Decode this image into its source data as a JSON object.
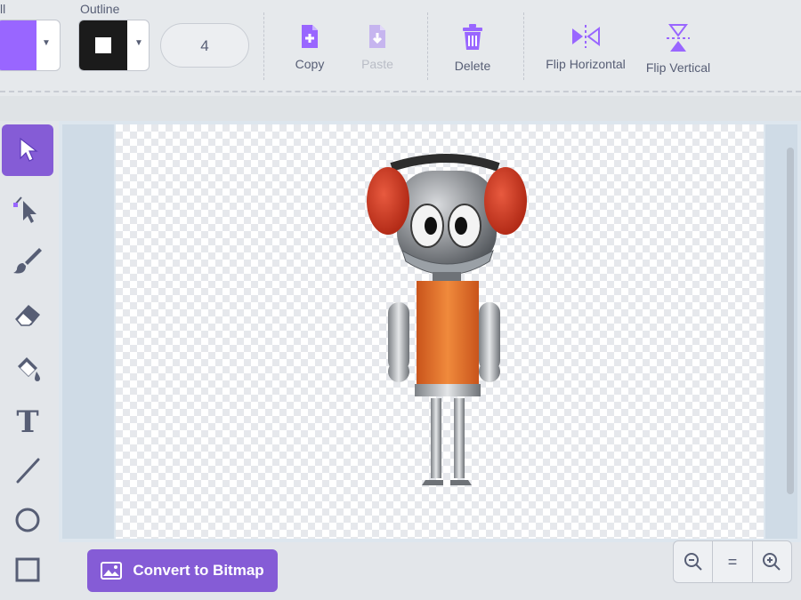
{
  "toolbar": {
    "fill_label": "ll",
    "outline_label": "Outline",
    "outline_width": "4",
    "copy_label": "Copy",
    "paste_label": "Paste",
    "delete_label": "Delete",
    "flip_horizontal_label": "Flip Horizontal",
    "flip_vertical_label": "Flip Vertical",
    "fill_color": "#9966ff",
    "outline_color": "#1b1b1b"
  },
  "tools": {
    "items": [
      "select-icon",
      "reshape-icon",
      "brush-icon",
      "eraser-icon",
      "fill-icon",
      "text-icon",
      "line-icon",
      "circle-icon",
      "rectangle-icon"
    ],
    "selected": "select-icon",
    "text_glyph": "T"
  },
  "bottom": {
    "convert_label": "Convert to Bitmap",
    "zoom_out_icon": "zoom-out-icon",
    "zoom_reset_label": "=",
    "zoom_in_icon": "zoom-in-icon"
  },
  "colors": {
    "accent": "#855cd6",
    "ear_red": "#d9412b",
    "body_orange": "#e26b26",
    "metal_gray": "#a8acb0"
  }
}
